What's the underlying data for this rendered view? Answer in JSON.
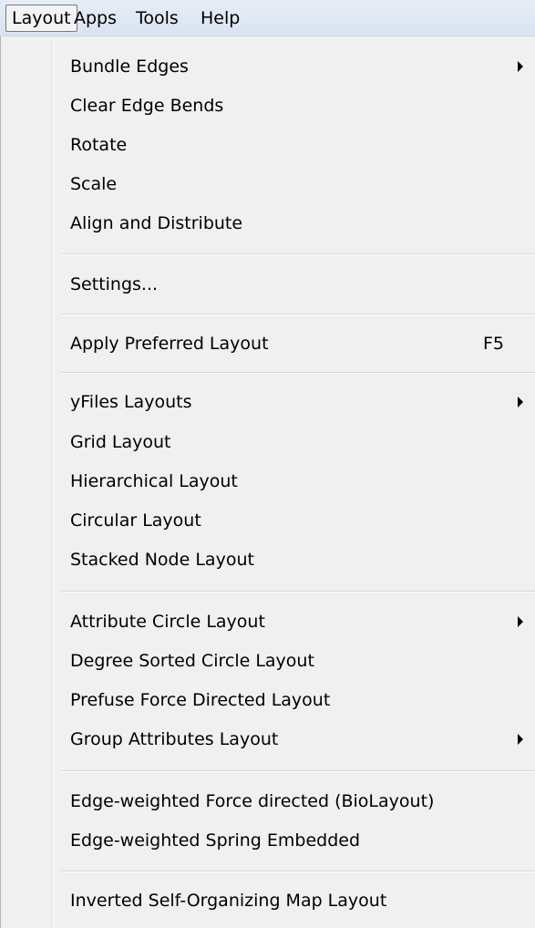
{
  "menubar": {
    "items": [
      {
        "label": "Layout"
      },
      {
        "label": "Apps"
      },
      {
        "label": "Tools"
      },
      {
        "label": "Help"
      }
    ]
  },
  "menu": {
    "groups": [
      [
        {
          "label": "Bundle Edges",
          "submenu": true
        },
        {
          "label": "Clear Edge Bends"
        },
        {
          "label": "Rotate"
        },
        {
          "label": "Scale"
        },
        {
          "label": "Align and Distribute"
        }
      ],
      [
        {
          "label": "Settings..."
        }
      ],
      [
        {
          "label": "Apply Preferred Layout",
          "shortcut": "F5"
        }
      ],
      [
        {
          "label": "yFiles Layouts",
          "submenu": true
        },
        {
          "label": "Grid Layout"
        },
        {
          "label": "Hierarchical Layout"
        },
        {
          "label": "Circular Layout"
        },
        {
          "label": "Stacked Node Layout"
        }
      ],
      [
        {
          "label": "Attribute Circle Layout",
          "submenu": true
        },
        {
          "label": "Degree Sorted Circle Layout"
        },
        {
          "label": "Prefuse Force Directed Layout"
        },
        {
          "label": "Group Attributes Layout",
          "submenu": true
        }
      ],
      [
        {
          "label": "Edge-weighted Force directed (BioLayout)"
        },
        {
          "label": "Edge-weighted Spring Embedded"
        }
      ],
      [
        {
          "label": "Inverted Self-Organizing Map Layout"
        }
      ]
    ]
  }
}
